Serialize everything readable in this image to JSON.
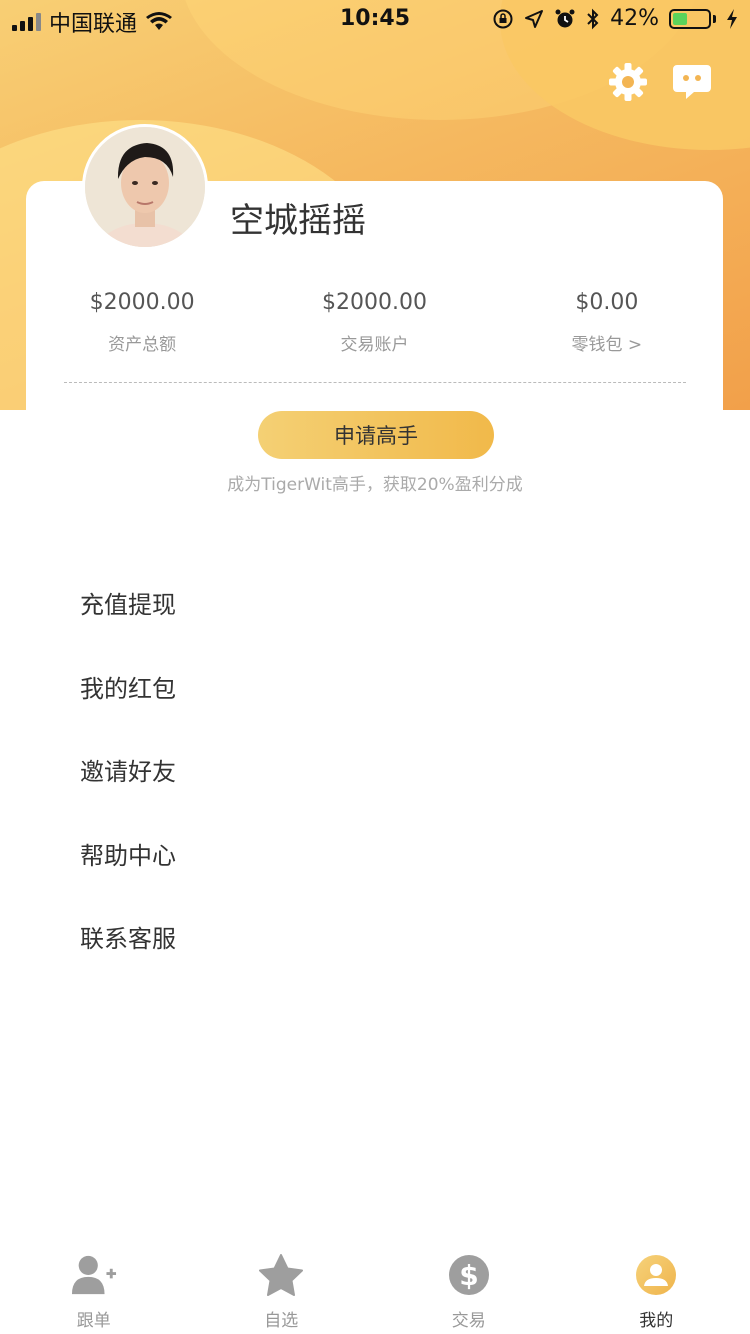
{
  "status_bar": {
    "carrier": "中国联通",
    "time": "10:45",
    "battery": "42%",
    "battery_level": 0.42
  },
  "header": {
    "icons": [
      "gear-icon",
      "message-icon"
    ]
  },
  "profile": {
    "name": "空城摇摇",
    "stats": [
      {
        "value": "$2000.00",
        "label": "资产总额"
      },
      {
        "value": "$2000.00",
        "label": "交易账户"
      },
      {
        "value": "$0.00",
        "label": "零钱包 >"
      }
    ]
  },
  "apply": {
    "button_label": "申请高手",
    "hint": "成为TigerWit高手，获取20%盈利分成"
  },
  "menu": {
    "items": [
      "充值提现",
      "我的红包",
      "邀请好友",
      "帮助中心",
      "联系客服"
    ]
  },
  "tabs": [
    {
      "label": "跟单",
      "icon": "add-user-icon"
    },
    {
      "label": "自选",
      "icon": "star-icon"
    },
    {
      "label": "交易",
      "icon": "dollar-icon"
    },
    {
      "label": "我的",
      "icon": "user-icon",
      "active": true
    }
  ],
  "colors": {
    "accent": "#f4bf52",
    "battery_fill": "#5bd35b"
  }
}
